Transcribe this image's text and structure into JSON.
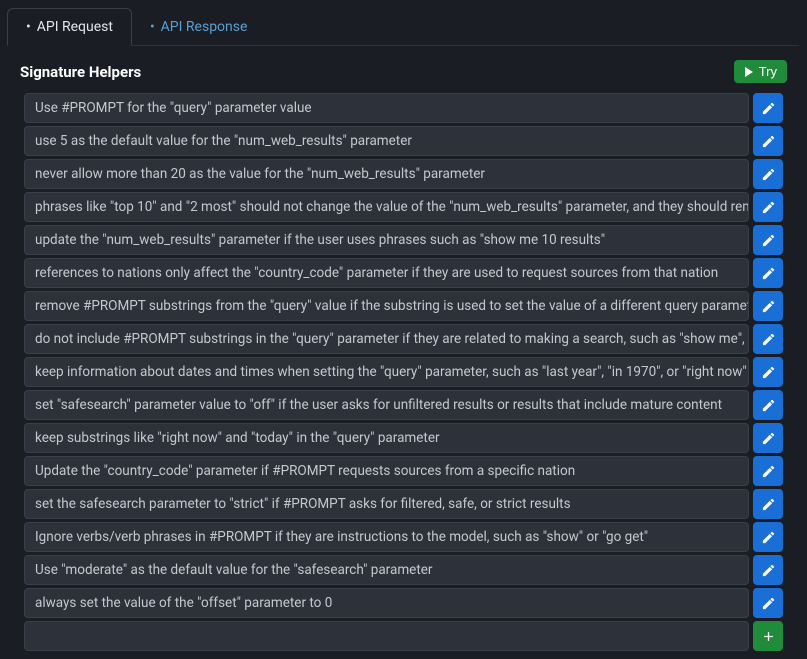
{
  "tabs": {
    "request": "API Request",
    "response": "API Response"
  },
  "section": {
    "title": "Signature Helpers",
    "try_label": "Try"
  },
  "helpers": [
    "Use #PROMPT for the \"query\" parameter value",
    "use 5 as the default value for the \"num_web_results\" parameter",
    "never allow more than 20 as the value for the \"num_web_results\" parameter",
    "phrases like \"top 10\" and \"2 most\" should not change the value of the \"num_web_results\" parameter, and they should rem",
    "update the \"num_web_results\" parameter if the user uses phrases such as \"show me 10 results\"",
    "references to nations only affect the \"country_code\" parameter if they are used to request sources from that nation",
    "remove #PROMPT substrings from the \"query\" value if the substring is used to set the value of a different query parameter",
    "do not include #PROMPT substrings in the \"query\" parameter if they are related to making a search, such as \"show me\", \"",
    "keep information about dates and times when setting the \"query\" parameter, such as \"last year\", \"in 1970\", or \"right now\"",
    "set \"safesearch\" parameter value to \"off\" if the user asks for unfiltered results or results that include mature content",
    "keep substrings like \"right now\" and \"today\" in the \"query\" parameter",
    "Update the \"country_code\" parameter if #PROMPT requests sources from a specific nation",
    "set the safesearch parameter to \"strict\" if #PROMPT asks for filtered, safe, or strict results",
    "Ignore verbs/verb phrases in #PROMPT if they are instructions to the model, such as \"show\" or \"go get\"",
    "Use \"moderate\" as the default value for the \"safesearch\" parameter",
    "always set the value of the \"offset\" parameter to 0"
  ]
}
